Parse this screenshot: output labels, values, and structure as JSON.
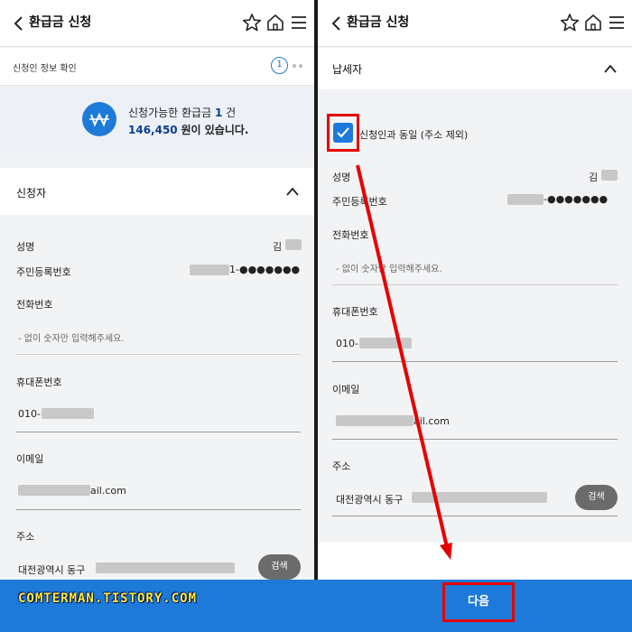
{
  "header": {
    "title": "환급금 신청"
  },
  "left": {
    "step_title": "신청인 정보 확인",
    "step_number": "1",
    "summary_line1_prefix": "신청가능한 환급금",
    "summary_count": "1",
    "summary_count_unit": "건",
    "summary_amount": "146,450",
    "summary_line2_suffix": "원이 있습니다.",
    "section_title": "신청자",
    "name_label": "성명",
    "name_value": "김",
    "rrn_label": "주민등록번호",
    "rrn_value": "1-●●●●●●●",
    "phone_label": "전화번호",
    "phone_placeholder": "- 없이 숫자만 입력해주세요.",
    "mobile_label": "휴대폰번호",
    "mobile_value": "010-",
    "email_label": "이메일",
    "email_value": "ail.com",
    "address_label": "주소",
    "address_value": "대전광역시 동구",
    "search_button": "검색"
  },
  "right": {
    "section_title": "납세자",
    "same_checkbox_label": "신청인과 동일 (주소 제외)",
    "same_checked": true,
    "name_label": "성명",
    "name_value": "김",
    "rrn_label": "주민등록번호",
    "rrn_value": "-●●●●●●●",
    "phone_label": "전화번호",
    "phone_placeholder": "- 없이 숫자만 입력해주세요.",
    "mobile_label": "휴대폰번호",
    "mobile_value": "010-",
    "email_label": "이메일",
    "email_value": "ail.com",
    "address_label": "주소",
    "address_value": "대전광역시 동구",
    "search_button": "검색",
    "next_button": "다음"
  },
  "watermark": "COMTERMAN.TISTORY.COM",
  "icons": [
    "chevron-left-icon",
    "star-icon",
    "home-icon",
    "menu-icon",
    "won-icon",
    "chevron-up-icon",
    "check-icon"
  ],
  "colors": {
    "accent": "#1e7ad9",
    "highlight": "#e60000",
    "amount": "#0a3d8f",
    "brand": "#ffe94a"
  }
}
